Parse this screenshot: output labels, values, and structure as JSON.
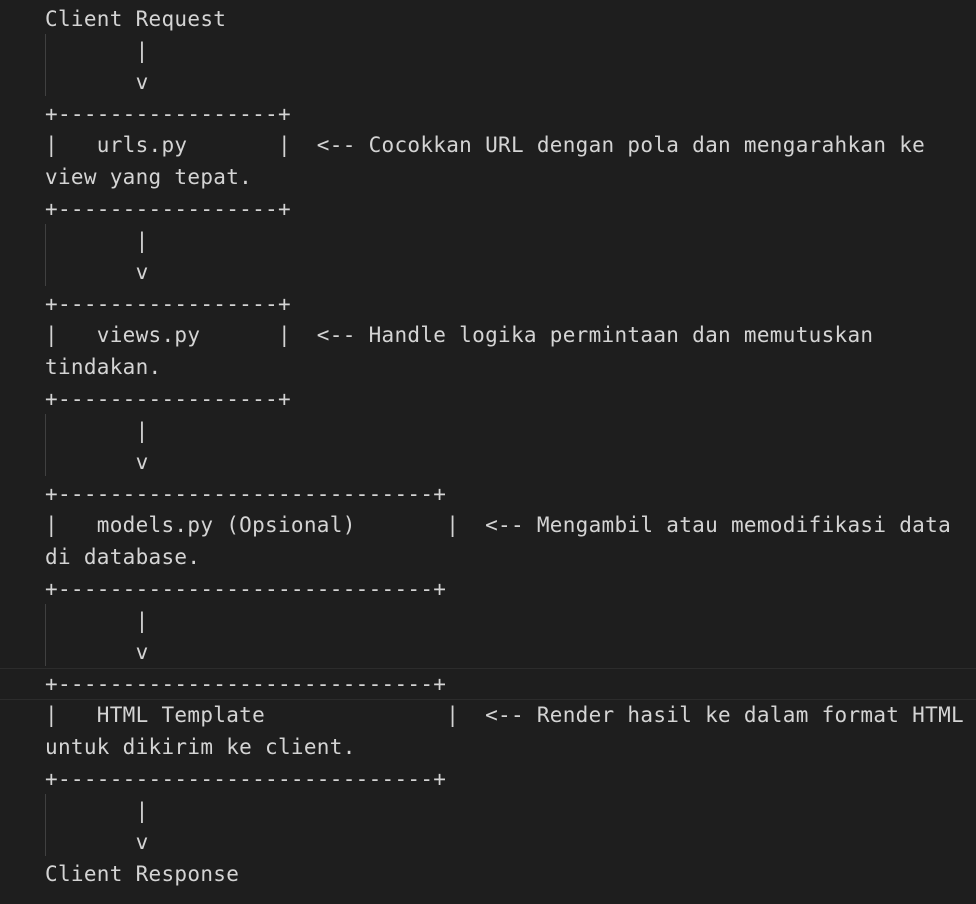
{
  "editor": {
    "lines": [
      "Client Request",
      "       |",
      "       v",
      "+-----------------+",
      "|   urls.py       |  <-- Cocokkan URL dengan pola dan mengarahkan ke",
      "view yang tepat.",
      "+-----------------+",
      "       |",
      "       v",
      "+-----------------+",
      "|   views.py      |  <-- Handle logika permintaan dan memutuskan",
      "tindakan.",
      "+-----------------+",
      "       |",
      "       v",
      "+-----------------------------+",
      "|   models.py (Opsional)       |  <-- Mengambil atau memodifikasi data",
      "di database.",
      "+-----------------------------+",
      "       |",
      "       v",
      "+-----------------------------+",
      "|   HTML Template              |  <-- Render hasil ke dalam format HTML",
      "untuk dikirim ke client.",
      "+-----------------------------+",
      "       |",
      "       v",
      "Client Response"
    ]
  }
}
